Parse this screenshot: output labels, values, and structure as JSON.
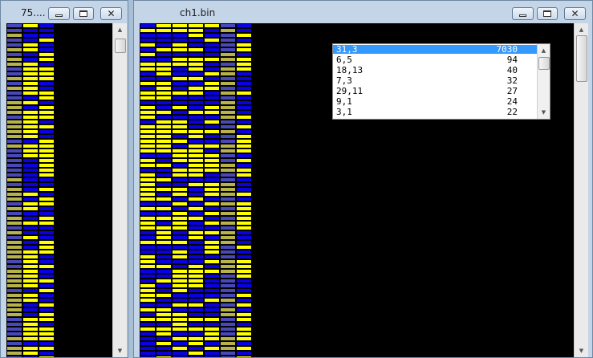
{
  "left_window": {
    "title": "75....",
    "icons": {
      "minimize": "minimize-icon",
      "maximize": "maximize-icon",
      "close": "close-icon"
    }
  },
  "right_window": {
    "title": "ch1.bin",
    "icons": {
      "minimize": "minimize-icon",
      "maximize": "maximize-icon",
      "close": "close-icon"
    }
  },
  "popup": {
    "rows": [
      {
        "key": "31,3",
        "count": "7030",
        "selected": true
      },
      {
        "key": "6,5",
        "count": "94"
      },
      {
        "key": "18,13",
        "count": "40"
      },
      {
        "key": "7,3",
        "count": "32"
      },
      {
        "key": "29,11",
        "count": "27"
      },
      {
        "key": "9,1",
        "count": "24"
      },
      {
        "key": "3,1",
        "count": "22"
      }
    ]
  },
  "colors": {
    "blue": "#0a00e0",
    "yellow": "#ffff00",
    "olive": "#b7b24a",
    "slate": "#4848b8",
    "background": "#000000",
    "selection": "#3399ff"
  }
}
